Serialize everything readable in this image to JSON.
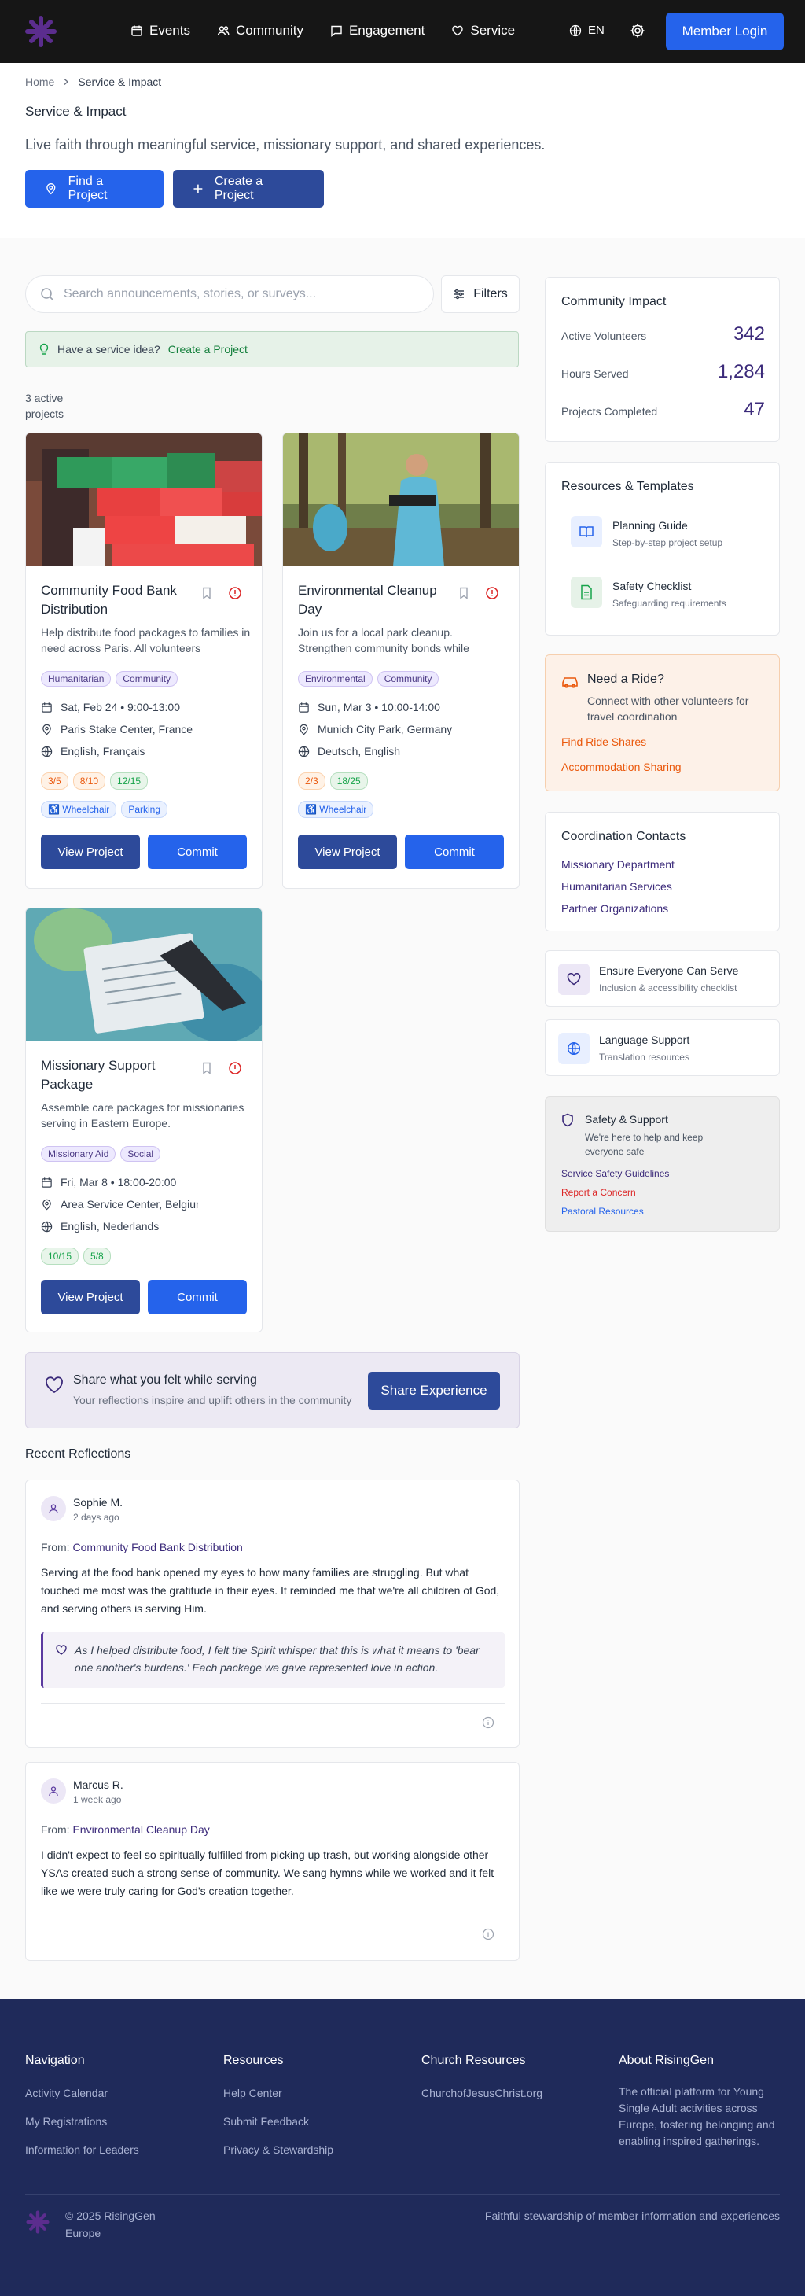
{
  "header": {
    "nav": [
      "Events",
      "Community",
      "Engagement",
      "Service"
    ],
    "lang": "EN",
    "login": "Member Login"
  },
  "hero": {
    "breadcrumb": [
      "Home",
      "Service & Impact"
    ],
    "title": "Service & Impact",
    "subtitle": "Live faith through meaningful service, missionary support, and shared experiences.",
    "find_btn": "Find a Project",
    "create_btn": "Create a Project"
  },
  "search": {
    "placeholder": "Search announcements, stories, or surveys...",
    "filters": "Filters"
  },
  "idea": {
    "text": "Have a service idea?",
    "link": "Create a Project"
  },
  "count": {
    "line1": "3 active",
    "line2": "projects"
  },
  "cards": [
    {
      "title": "Community Food Bank Distribution",
      "desc": "Help distribute food packages to families in need across Paris. All volunteers",
      "tags": [
        "Humanitarian",
        "Community"
      ],
      "date": "Sat, Feb 24 • 9:00-13:00",
      "place": "Paris Stake Center, France",
      "langs": "English, Français",
      "pills": [
        "3/5",
        "8/10",
        "12/15"
      ],
      "acc": [
        "♿ Wheelchair",
        "Parking"
      ],
      "view": "View Project",
      "commit": "Commit"
    },
    {
      "title": "Environmental Cleanup Day",
      "desc": "Join us for a local park cleanup. Strengthen community bonds while",
      "tags": [
        "Environmental",
        "Community"
      ],
      "date": "Sun, Mar 3 • 10:00-14:00",
      "place": "Munich City Park, Germany",
      "langs": "Deutsch, English",
      "pills": [
        "2/3",
        "18/25"
      ],
      "acc": [
        "♿ Wheelchair"
      ],
      "view": "View Project",
      "commit": "Commit"
    },
    {
      "title": "Missionary Support Package",
      "desc": "Assemble care packages for missionaries serving in Eastern Europe.",
      "tags": [
        "Missionary Aid",
        "Social"
      ],
      "date": "Fri, Mar 8 • 18:00-20:00",
      "place": "Area Service Center, Belgium",
      "langs": "English, Nederlands",
      "pills": [
        "10/15",
        "5/8"
      ],
      "view": "View Project",
      "commit": "Commit"
    }
  ],
  "share": {
    "title": "Share what you felt while serving",
    "sub": "Your reflections inspire and uplift others in the community",
    "btn": "Share Experience"
  },
  "reflections": {
    "title": "Recent Reflections",
    "items": [
      {
        "name": "Sophie M.",
        "time": "2 days ago",
        "from_label": "From:",
        "from": "Community Food Bank Distribution",
        "body": "Serving at the food bank opened my eyes to how many families are struggling. But what touched me most was the gratitude in their eyes. It reminded me that we're all children of God, and serving others is serving Him.",
        "quote": "As I helped distribute food, I felt the Spirit whisper that this is what it means to 'bear one another's burdens.' Each package we gave represented love in action."
      },
      {
        "name": "Marcus R.",
        "time": "1 week ago",
        "from_label": "From:",
        "from": "Environmental Cleanup Day",
        "body": "I didn't expect to feel so spiritually fulfilled from picking up trash, but working alongside other YSAs created such a strong sense of community. We sang hymns while we worked and it felt like we were truly caring for God's creation together."
      }
    ]
  },
  "impact": {
    "title": "Community Impact",
    "stats": [
      {
        "label": "Active Volunteers",
        "value": "342"
      },
      {
        "label": "Hours Served",
        "value": "1,284"
      },
      {
        "label": "Projects Completed",
        "value": "47"
      }
    ]
  },
  "resources": {
    "title": "Resources & Templates",
    "items": [
      {
        "title": "Planning Guide",
        "sub": "Step-by-step project setup"
      },
      {
        "title": "Safety Checklist",
        "sub": "Safeguarding requirements"
      }
    ]
  },
  "ride": {
    "title": "Need a Ride?",
    "sub": "Connect with other volunteers for travel coordination",
    "links": [
      "Find Ride Shares",
      "Accommodation Sharing"
    ]
  },
  "contacts": {
    "title": "Coordination Contacts",
    "links": [
      "Missionary Department",
      "Humanitarian Services",
      "Partner Organizations"
    ]
  },
  "inclusive": {
    "title": "Ensure Everyone Can Serve",
    "sub": "Inclusion & accessibility checklist"
  },
  "language": {
    "title": "Language Support",
    "sub": "Translation resources"
  },
  "safety": {
    "title": "Safety & Support",
    "sub": "We're here to help and keep everyone safe",
    "links": [
      "Service Safety Guidelines",
      "Report a Concern",
      "Pastoral Resources"
    ]
  },
  "footer": {
    "nav_h": "Navigation",
    "nav": [
      "Activity Calendar",
      "My Registrations",
      "Information for Leaders"
    ],
    "res_h": "Resources",
    "res": [
      "Help Center",
      "Submit Feedback",
      "Privacy & Stewardship"
    ],
    "church_h": "Church Resources",
    "church": [
      "ChurchofJesusChrist.org"
    ],
    "about_h": "About RisingGen",
    "about": "The official platform for Young Single Adult activities across Europe, fostering belonging and enabling inspired gatherings.",
    "copy1": "© 2025 RisingGen",
    "copy2": "Europe",
    "tagline": "Faithful stewardship of member information and experiences"
  }
}
